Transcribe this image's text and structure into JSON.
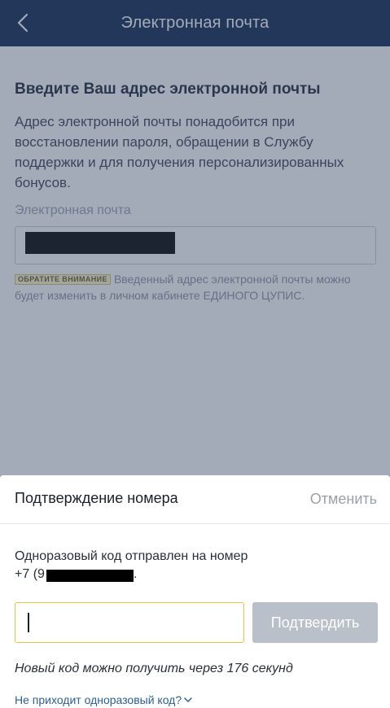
{
  "appbar": {
    "title": "Электронная почта",
    "back_icon": "chevron-left-icon"
  },
  "email_form": {
    "heading": "Введите Ваш адрес электронной почты",
    "description": "Адрес электронной почты понадобится при восстановлении пароля, обращении в Службу поддержки и для получения персонализированных бонусов.",
    "field_label": "Электронная почта",
    "note_badge": "ОБРАТИТЕ ВНИМАНИЕ",
    "note_text": "Введенный адрес электронной почты можно будет изменить в личном кабинете ЕДИНОГО ЦУПИС."
  },
  "sheet": {
    "title": "Подтверждение номера",
    "cancel_label": "Отменить",
    "sent_text": "Одноразовый код отправлен на номер",
    "phone_prefix": "+7 (9",
    "phone_suffix": ".",
    "confirm_label": "Подтвердить",
    "timer_text": "Новый код можно получить через 176 секунд",
    "no_code_link": "Не приходит одноразовый код?"
  },
  "colors": {
    "appbar": "#0e2750",
    "overlay": "rgba(60,75,105,0.47)",
    "code_input_border": "#e2c44a",
    "confirm_disabled": "#b9c0c9",
    "link": "#2f5f8a"
  }
}
